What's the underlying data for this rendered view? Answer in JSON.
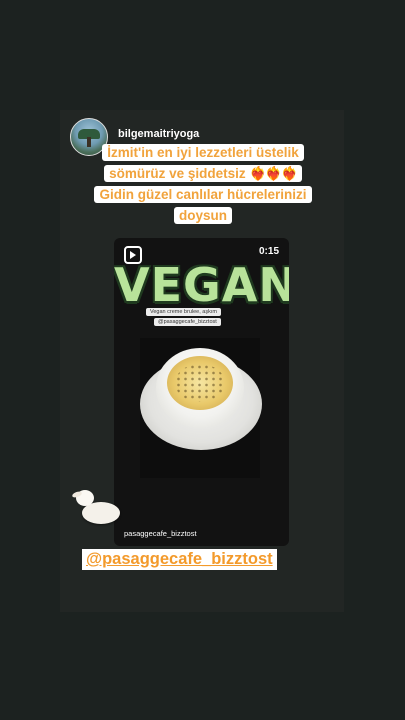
{
  "story": {
    "username": "bilgemaitriyoga",
    "avatar_icon": "avatar-landscape",
    "caption_lines": [
      "İzmit'in en iyi lezzetleri üstelik",
      "sömürüz ve şiddetsiz",
      "Gidin güzel canlılar hücrelerinizi",
      "doysun"
    ],
    "hearts": "❤️‍🔥❤️‍🔥❤️‍🔥",
    "mention_sticker": "@pasaggecafe_bizztost",
    "sticker_icon": "lamb-icon"
  },
  "reel": {
    "duration": "0:15",
    "title": "VEGAN",
    "subtitle": "Vegan creme brulee, aşkım",
    "handle_pill": "@pasaggecafe_bizztost",
    "owner": "pasaggecafe_bizztost",
    "reel_icon": "reels-icon"
  },
  "colors": {
    "background": "#1c2220",
    "story_panel": "#222624",
    "caption_text": "#f1a33c",
    "mention_text": "#f39a2b",
    "vegan_title": "#b8e39a"
  }
}
